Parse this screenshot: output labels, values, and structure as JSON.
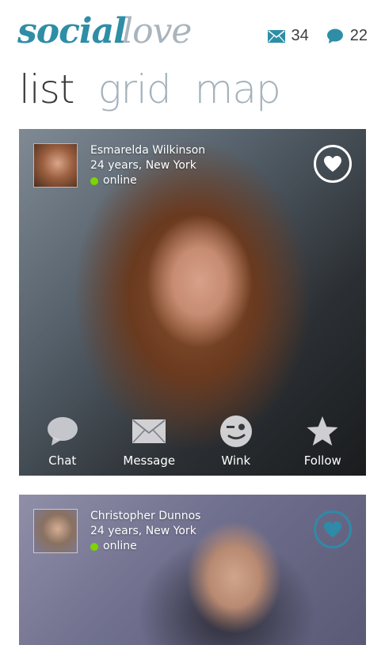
{
  "app": {
    "logo_part1": "social",
    "logo_part2": "love",
    "colors": {
      "brand": "#2e8ea6",
      "brand_light": "#a9b4bd",
      "online": "#7cd400"
    }
  },
  "header": {
    "messages_count": "34",
    "messages_icon": "envelope-icon",
    "chats_count": "22",
    "chats_icon": "chat-bubble-icon"
  },
  "tabs": [
    {
      "label": "list",
      "active": true
    },
    {
      "label": "grid",
      "active": false
    },
    {
      "label": "map",
      "active": false
    }
  ],
  "cards": [
    {
      "name": "Esmarelda Wilkinson",
      "details": "24 years, New York",
      "status": "online",
      "favorite_icon": "heart-icon",
      "actions": [
        {
          "label": "Chat",
          "icon": "chat-bubble-icon"
        },
        {
          "label": "Message",
          "icon": "envelope-icon"
        },
        {
          "label": "Wink",
          "icon": "wink-face-icon"
        },
        {
          "label": "Follow",
          "icon": "star-icon"
        }
      ]
    },
    {
      "name": "Christopher Dunnos",
      "details": "24 years, New York",
      "status": "online",
      "favorite_icon": "heart-icon"
    }
  ]
}
